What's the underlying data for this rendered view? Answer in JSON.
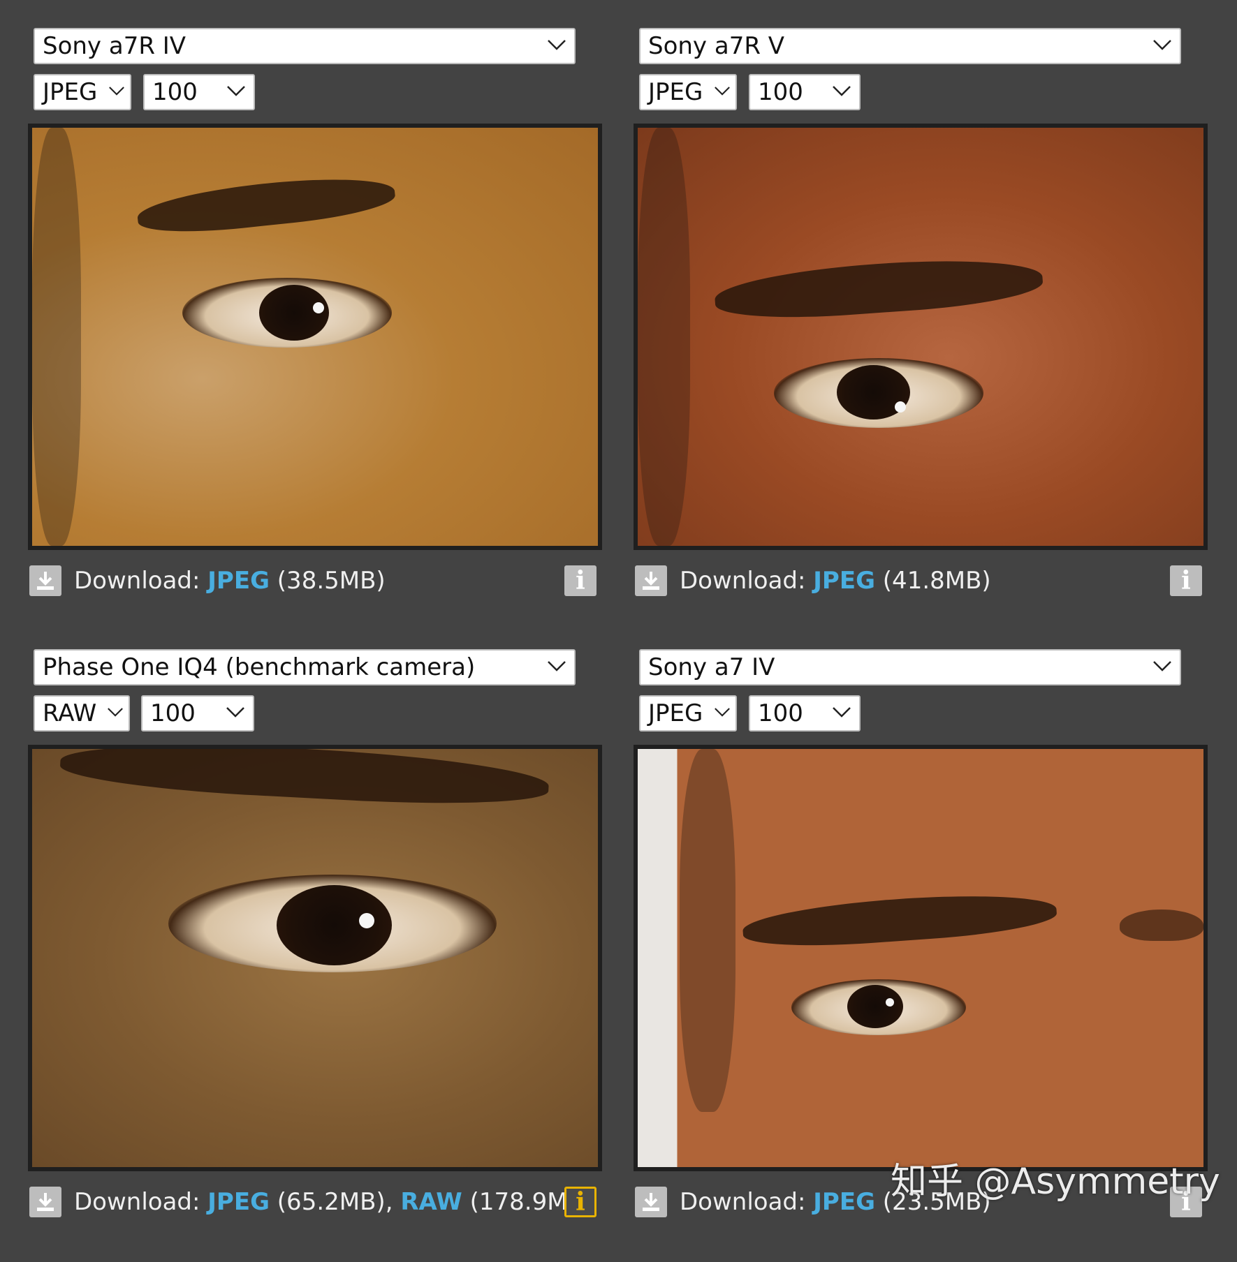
{
  "panels": [
    {
      "camera": "Sony a7R IV",
      "format": "JPEG",
      "iso": "100",
      "download": {
        "prefix": "Download:",
        "links": [
          {
            "label": "JPEG",
            "size": "(38.5MB)"
          }
        ],
        "info_icon": "info-icon"
      }
    },
    {
      "camera": "Sony a7R V",
      "format": "JPEG",
      "iso": "100",
      "download": {
        "prefix": "Download:",
        "links": [
          {
            "label": "JPEG",
            "size": "(41.8MB)"
          }
        ],
        "info_icon": "info-icon"
      }
    },
    {
      "camera": "Phase One IQ4 (benchmark camera)",
      "format": "RAW",
      "iso": "100",
      "download": {
        "prefix": "Download:",
        "links": [
          {
            "label": "JPEG",
            "size": "(65.2MB),"
          },
          {
            "label": "RAW",
            "size": "(178.9MB)"
          }
        ],
        "info_icon": "info-icon",
        "info_active": true
      }
    },
    {
      "camera": "Sony a7 IV",
      "format": "JPEG",
      "iso": "100",
      "download": {
        "prefix": "Download:",
        "links": [
          {
            "label": "JPEG",
            "size": "(23.5MB)"
          }
        ],
        "info_icon": "info-icon"
      }
    }
  ],
  "icons": {
    "download": "download-icon",
    "dropdown": "chevron-down-icon",
    "info": "info-icon"
  },
  "colors": {
    "background": "#434343",
    "link": "#49aee0",
    "info_active_border": "#e9b300"
  },
  "watermark": "知乎 @Asymmetry"
}
